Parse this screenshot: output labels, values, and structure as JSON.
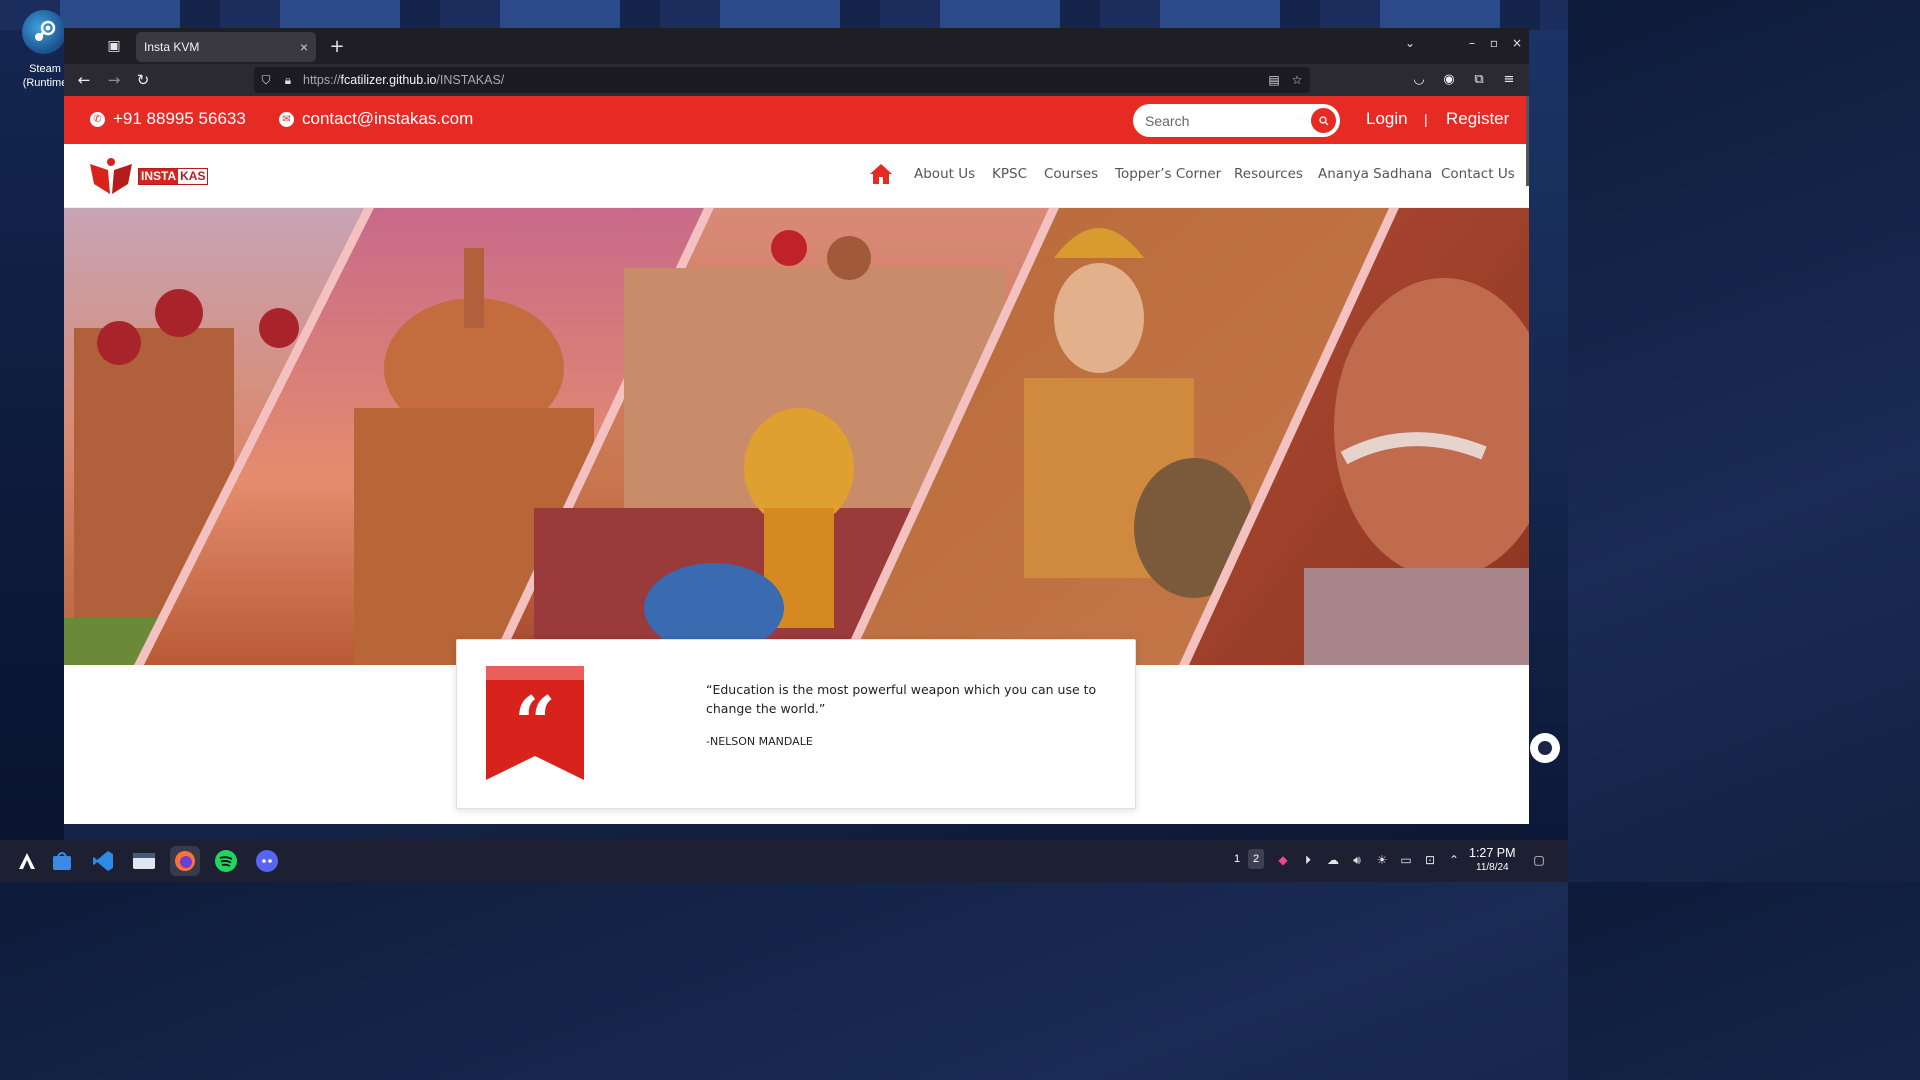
{
  "desktop": {
    "steam_label": "Steam (Runtime"
  },
  "browser": {
    "tab_title": "Insta KVM",
    "url": {
      "protocol": "https://",
      "host": "fcatilizer.github.io",
      "path": "/INSTAKAS/"
    }
  },
  "site": {
    "topbar": {
      "phone": "+91 88995 56633",
      "email": "contact@instakas.com",
      "search_placeholder": "Search",
      "login": "Login",
      "separator": "|",
      "register": "Register"
    },
    "logo": {
      "part1": "INSTA",
      "part2": "KAS"
    },
    "nav": [
      "About Us",
      "KPSC",
      "Courses",
      "Topper’s Corner",
      "Resources",
      "Ananya Sadhana",
      "Contact Us"
    ],
    "quote": {
      "text": "“Education is the most powerful weapon which you can use to change the world.”",
      "author": "-NELSON MANDALE"
    },
    "colors": {
      "brand_red": "#e52b24"
    }
  },
  "taskbar": {
    "desktops": [
      "1",
      "2"
    ],
    "time": "1:27 PM",
    "date": "11/8/24"
  }
}
